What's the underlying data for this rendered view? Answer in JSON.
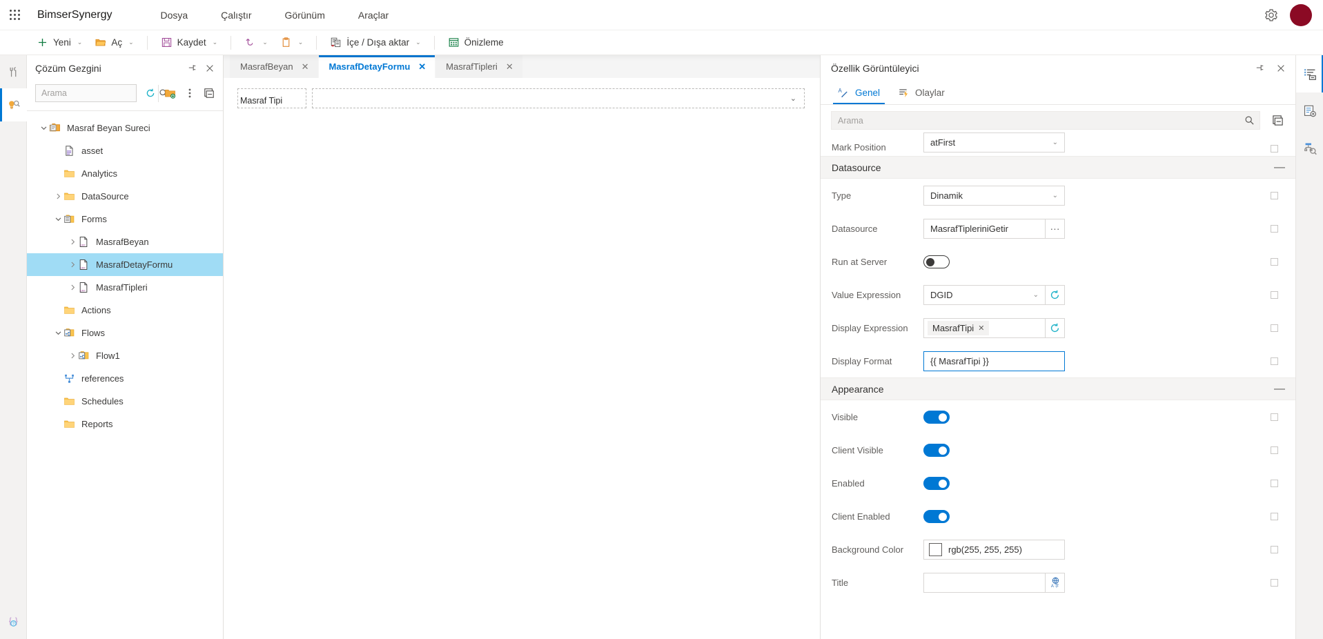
{
  "topbar": {
    "brand": "BimserSynergy",
    "menus": [
      {
        "label": "Dosya",
        "name": "menu-dosya"
      },
      {
        "label": "Çalıştır",
        "name": "menu-calistir"
      },
      {
        "label": "Görünüm",
        "name": "menu-gorunum"
      },
      {
        "label": "Araçlar",
        "name": "menu-araclar"
      }
    ],
    "settings_icon": "gear-icon",
    "avatar_color": "#8b0a24"
  },
  "ribbon": {
    "items": [
      {
        "label": "Yeni",
        "icon": "plus-icon",
        "caret": true
      },
      {
        "label": "Aç",
        "icon": "folder-open-icon",
        "caret": true
      },
      {
        "label": "Kaydet",
        "icon": "save-floppy-icon",
        "caret": true
      },
      {
        "label": "",
        "icon": "undo-icon",
        "caret": true
      },
      {
        "label": "",
        "icon": "clipboard-icon",
        "caret": true
      },
      {
        "label": "İçe / Dışa aktar",
        "icon": "import-export-icon",
        "caret": true
      },
      {
        "label": "Önizleme",
        "icon": "preview-grid-icon",
        "caret": false
      }
    ]
  },
  "left_rail": {
    "items": [
      {
        "name": "toolbox-icon",
        "active": false
      },
      {
        "name": "solution-explorer-icon",
        "active": true
      }
    ],
    "bottom": {
      "name": "code-help-icon"
    }
  },
  "explorer": {
    "title": "Çözüm Gezgini",
    "pin_icon": "pin-icon",
    "close_icon": "close-icon",
    "search": {
      "value": "",
      "placeholder": "Arama",
      "search_icon": "search-icon"
    },
    "toolbar": [
      {
        "name": "refresh-icon"
      },
      {
        "name": "new-folder-icon"
      },
      {
        "name": "more-options-icon"
      },
      {
        "name": "collapse-all-icon"
      }
    ],
    "tree": [
      {
        "label": "Masraf Beyan Sureci",
        "indent": 0,
        "twisty": "down",
        "icon": "solution-icon",
        "selected": false
      },
      {
        "label": "asset",
        "indent": 1,
        "twisty": "none",
        "icon": "asset-icon",
        "selected": false
      },
      {
        "label": "Analytics",
        "indent": 1,
        "twisty": "none",
        "icon": "folder-icon",
        "selected": false
      },
      {
        "label": "DataSource",
        "indent": 1,
        "twisty": "right",
        "icon": "folder-icon",
        "selected": false
      },
      {
        "label": "Forms",
        "indent": 1,
        "twisty": "down",
        "icon": "forms-folder-icon",
        "selected": false
      },
      {
        "label": "MasrafBeyan",
        "indent": 2,
        "twisty": "right",
        "icon": "form-file-icon",
        "selected": false
      },
      {
        "label": "MasrafDetayFormu",
        "indent": 2,
        "twisty": "right",
        "icon": "form-file-icon",
        "selected": true
      },
      {
        "label": "MasrafTipleri",
        "indent": 2,
        "twisty": "right",
        "icon": "form-file-icon",
        "selected": false
      },
      {
        "label": "Actions",
        "indent": 1,
        "twisty": "none",
        "icon": "folder-icon",
        "selected": false
      },
      {
        "label": "Flows",
        "indent": 1,
        "twisty": "down",
        "icon": "flows-folder-icon",
        "selected": false
      },
      {
        "label": "Flow1",
        "indent": 2,
        "twisty": "right",
        "icon": "flow-icon",
        "selected": false
      },
      {
        "label": "references",
        "indent": 1,
        "twisty": "none",
        "icon": "references-icon",
        "selected": false
      },
      {
        "label": "Schedules",
        "indent": 1,
        "twisty": "none",
        "icon": "folder-icon",
        "selected": false
      },
      {
        "label": "Reports",
        "indent": 1,
        "twisty": "none",
        "icon": "folder-icon",
        "selected": false
      }
    ]
  },
  "designer": {
    "tabs": [
      {
        "label": "MasrafBeyan",
        "active": false
      },
      {
        "label": "MasrafDetayFormu",
        "active": true
      },
      {
        "label": "MasrafTipleri",
        "active": false
      }
    ],
    "tab_close_glyph": "✕",
    "form": {
      "field_label": "Masraf Tipi",
      "combo_value": "",
      "combo_caret_icon": "chevron-down-icon"
    }
  },
  "properties": {
    "title": "Özellik Görüntüleyici",
    "pin_icon": "pin-icon",
    "close_icon": "close-icon",
    "tabs": [
      {
        "label": "Genel",
        "icon": "general-pencil-icon",
        "active": true
      },
      {
        "label": "Olaylar",
        "icon": "events-lightning-icon",
        "active": false
      }
    ],
    "search": {
      "value": "",
      "placeholder": "Arama",
      "search_icon": "search-icon"
    },
    "collapse_all_icon": "collapse-all-icon",
    "rows": [
      {
        "kind": "select",
        "label": "Mark Position",
        "value": "atFirst",
        "clipped": true
      },
      {
        "kind": "section",
        "label": "Datasource",
        "collapse_glyph": "—"
      },
      {
        "kind": "select",
        "label": "Type",
        "value": "Dinamik"
      },
      {
        "kind": "select-ellipsis",
        "label": "Datasource",
        "value": "MasrafTipleriniGetir",
        "button_glyph": "···"
      },
      {
        "kind": "toggle",
        "label": "Run at Server",
        "on": false
      },
      {
        "kind": "select-refresh",
        "label": "Value Expression",
        "value": "DGID",
        "button_icon": "refresh-icon"
      },
      {
        "kind": "tag-refresh",
        "label": "Display Expression",
        "tag": "MasrafTipi",
        "tag_close": "✕",
        "button_icon": "refresh-icon"
      },
      {
        "kind": "textbox",
        "label": "Display Format",
        "value": "{{ MasrafTipi }}",
        "focused": true
      },
      {
        "kind": "section",
        "label": "Appearance",
        "collapse_glyph": "—"
      },
      {
        "kind": "toggle",
        "label": "Visible",
        "on": true
      },
      {
        "kind": "toggle",
        "label": "Client Visible",
        "on": true
      },
      {
        "kind": "toggle",
        "label": "Enabled",
        "on": true
      },
      {
        "kind": "toggle",
        "label": "Client Enabled",
        "on": true
      },
      {
        "kind": "color",
        "label": "Background Color",
        "value": "rgb(255, 255, 255)",
        "swatch": "#ffffff"
      },
      {
        "kind": "title-translate",
        "label": "Title",
        "value": "",
        "button_icon": "translate-icon"
      }
    ]
  },
  "right_rail": {
    "items": [
      {
        "name": "properties-list-icon",
        "active": true
      },
      {
        "name": "settings-list-icon",
        "active": false
      },
      {
        "name": "element-inspector-icon",
        "active": false
      }
    ]
  },
  "colors": {
    "accent": "#0078d4",
    "selection": "#a0dcf5",
    "avatar": "#8b0a24",
    "toggle_on": "#0078d4"
  }
}
